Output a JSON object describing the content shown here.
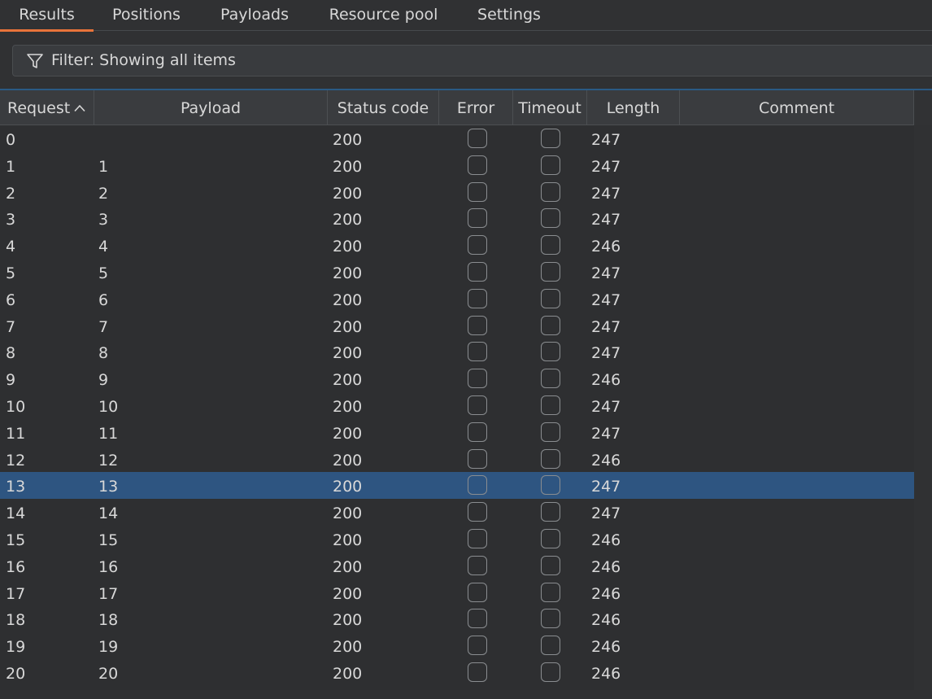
{
  "tabs": [
    {
      "label": "Results",
      "active": true
    },
    {
      "label": "Positions",
      "active": false
    },
    {
      "label": "Payloads",
      "active": false
    },
    {
      "label": "Resource pool",
      "active": false
    },
    {
      "label": "Settings",
      "active": false
    }
  ],
  "filter": {
    "icon": "filter-funnel-icon",
    "text": "Filter: Showing all items"
  },
  "table": {
    "columns": [
      "Request",
      "Payload",
      "Status code",
      "Error",
      "Timeout",
      "Length",
      "Comment"
    ],
    "sorted_column": "Request",
    "sort_direction": "ascending",
    "selected_request": "13",
    "rows": [
      {
        "request": "0",
        "payload": "",
        "status": "200",
        "error": false,
        "timeout": false,
        "length": "247",
        "comment": ""
      },
      {
        "request": "1",
        "payload": "1",
        "status": "200",
        "error": false,
        "timeout": false,
        "length": "247",
        "comment": ""
      },
      {
        "request": "2",
        "payload": "2",
        "status": "200",
        "error": false,
        "timeout": false,
        "length": "247",
        "comment": ""
      },
      {
        "request": "3",
        "payload": "3",
        "status": "200",
        "error": false,
        "timeout": false,
        "length": "247",
        "comment": ""
      },
      {
        "request": "4",
        "payload": "4",
        "status": "200",
        "error": false,
        "timeout": false,
        "length": "246",
        "comment": ""
      },
      {
        "request": "5",
        "payload": "5",
        "status": "200",
        "error": false,
        "timeout": false,
        "length": "247",
        "comment": ""
      },
      {
        "request": "6",
        "payload": "6",
        "status": "200",
        "error": false,
        "timeout": false,
        "length": "247",
        "comment": ""
      },
      {
        "request": "7",
        "payload": "7",
        "status": "200",
        "error": false,
        "timeout": false,
        "length": "247",
        "comment": ""
      },
      {
        "request": "8",
        "payload": "8",
        "status": "200",
        "error": false,
        "timeout": false,
        "length": "247",
        "comment": ""
      },
      {
        "request": "9",
        "payload": "9",
        "status": "200",
        "error": false,
        "timeout": false,
        "length": "246",
        "comment": ""
      },
      {
        "request": "10",
        "payload": "10",
        "status": "200",
        "error": false,
        "timeout": false,
        "length": "247",
        "comment": ""
      },
      {
        "request": "11",
        "payload": "11",
        "status": "200",
        "error": false,
        "timeout": false,
        "length": "247",
        "comment": ""
      },
      {
        "request": "12",
        "payload": "12",
        "status": "200",
        "error": false,
        "timeout": false,
        "length": "246",
        "comment": ""
      },
      {
        "request": "13",
        "payload": "13",
        "status": "200",
        "error": false,
        "timeout": false,
        "length": "247",
        "comment": ""
      },
      {
        "request": "14",
        "payload": "14",
        "status": "200",
        "error": false,
        "timeout": false,
        "length": "247",
        "comment": ""
      },
      {
        "request": "15",
        "payload": "15",
        "status": "200",
        "error": false,
        "timeout": false,
        "length": "246",
        "comment": ""
      },
      {
        "request": "16",
        "payload": "16",
        "status": "200",
        "error": false,
        "timeout": false,
        "length": "246",
        "comment": ""
      },
      {
        "request": "17",
        "payload": "17",
        "status": "200",
        "error": false,
        "timeout": false,
        "length": "246",
        "comment": ""
      },
      {
        "request": "18",
        "payload": "18",
        "status": "200",
        "error": false,
        "timeout": false,
        "length": "246",
        "comment": ""
      },
      {
        "request": "19",
        "payload": "19",
        "status": "200",
        "error": false,
        "timeout": false,
        "length": "246",
        "comment": ""
      },
      {
        "request": "20",
        "payload": "20",
        "status": "200",
        "error": false,
        "timeout": false,
        "length": "246",
        "comment": ""
      }
    ]
  },
  "colors": {
    "background": "#303133",
    "accent_tab_underline": "#e8733a",
    "selected_row": "#2e5581",
    "table_border_accent": "#2a5a85"
  }
}
